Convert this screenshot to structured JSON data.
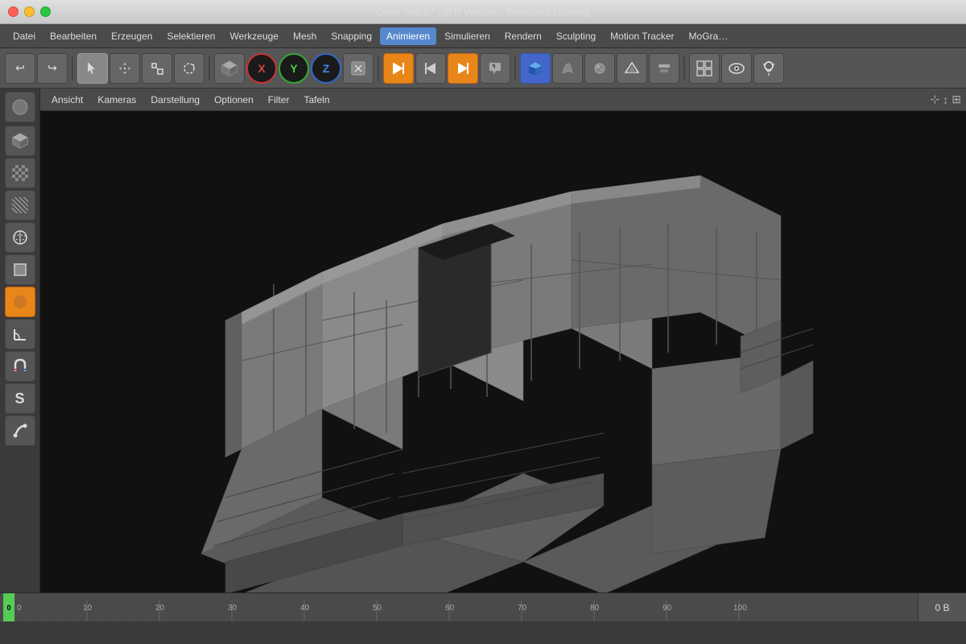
{
  "titlebar": {
    "title": "Ohne Titel 2 * (NFR Version – Restricted License)"
  },
  "menubar": {
    "items": [
      "Datei",
      "Bearbeiten",
      "Erzeugen",
      "Selektieren",
      "Werkzeuge",
      "Mesh",
      "Snapping",
      "Animieren",
      "Simulieren",
      "Rendern",
      "Sculpting",
      "Motion Tracker",
      "MoGra…"
    ]
  },
  "toolbar": {
    "left_group": [
      "undo",
      "redo",
      "select",
      "move",
      "scale",
      "rotate",
      "cube",
      "x-axis",
      "y-axis",
      "z-axis",
      "local"
    ],
    "right_group": [
      "play",
      "play-back",
      "play-fwd",
      "record",
      "cube-nav",
      "sculpt1",
      "sculpt2",
      "sculpt3",
      "sculpt4",
      "grid",
      "eyes",
      "lamp"
    ]
  },
  "viewport_subbar": {
    "items": [
      "Ansicht",
      "Kameras",
      "Darstellung",
      "Optionen",
      "Filter",
      "Tafeln"
    ]
  },
  "left_toolbar": {
    "items": [
      "move-tool",
      "draw-tool",
      "checker-tool",
      "grid-tool",
      "sphere-tool",
      "cube-tool",
      "orange-sphere",
      "angle-tool",
      "magnet-tool",
      "font-tool",
      "bend-tool"
    ]
  },
  "timeline": {
    "ticks": [
      0,
      10,
      20,
      30,
      40,
      50,
      60,
      70,
      80,
      90,
      100
    ],
    "current_frame": "0 B",
    "playhead_position": "0"
  },
  "scene": {
    "description": "3D architectural/modular mesh object - grey panels structure"
  }
}
